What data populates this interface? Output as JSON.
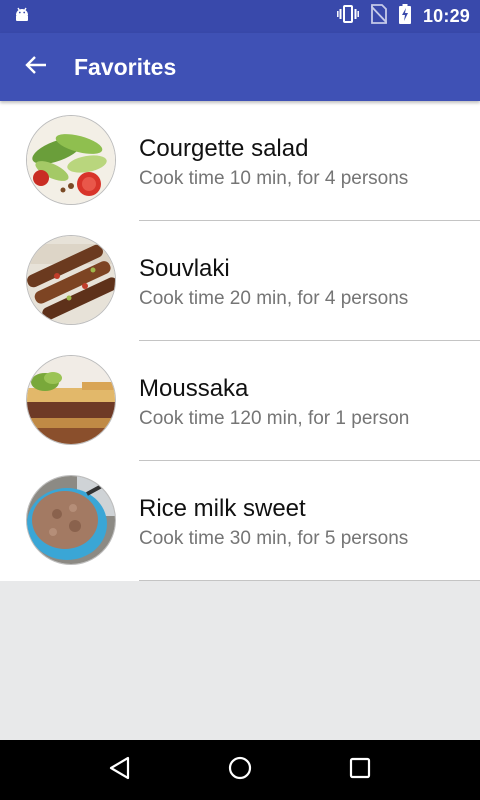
{
  "status_bar": {
    "time": "10:29",
    "icons": [
      "android-icon",
      "vibrate-icon",
      "no-sim-icon",
      "battery-charging-icon"
    ]
  },
  "app_bar": {
    "title": "Favorites",
    "back_icon": "arrow-back-icon"
  },
  "recipes": [
    {
      "title": "Courgette salad",
      "subtitle": "Cook time 10 min, for 4 persons",
      "image": "courgette-salad"
    },
    {
      "title": "Souvlaki",
      "subtitle": "Cook time 20 min, for 4 persons",
      "image": "souvlaki"
    },
    {
      "title": "Moussaka",
      "subtitle": "Cook time 120 min, for 1 person",
      "image": "moussaka"
    },
    {
      "title": "Rice milk sweet",
      "subtitle": "Cook time 30 min, for 5 persons",
      "image": "rice-milk-sweet"
    }
  ],
  "nav_bar": {
    "buttons": [
      "back-triangle-icon",
      "home-circle-icon",
      "recents-square-icon"
    ]
  },
  "colors": {
    "status_bar": "#3949ab",
    "app_bar": "#3f51b5",
    "background": "#e8e9ea"
  }
}
